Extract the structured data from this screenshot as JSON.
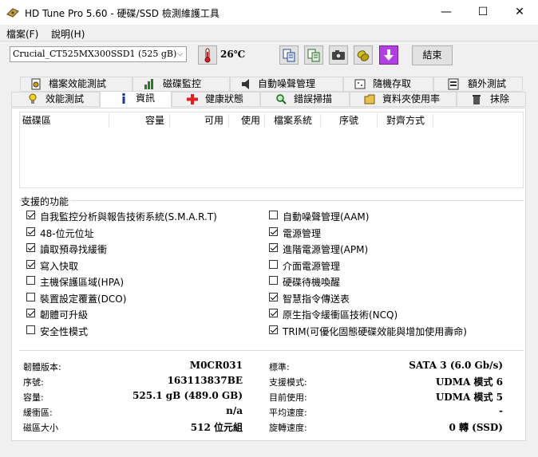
{
  "window": {
    "title": "HD Tune Pro 5.60 - 硬碟/SSD 檢測維護工具",
    "minimize": "—",
    "maximize": "☐",
    "close": "✕"
  },
  "menu": [
    "檔案(F)",
    "說明(H)"
  ],
  "toolbar": {
    "drive": "Crucial_CT525MX300SSD1 (525 gB)",
    "temperature": "26℃",
    "exit_label": "結束",
    "icons": [
      "thermometer-icon",
      "copy-text-icon",
      "copy-info-icon",
      "screenshot-icon",
      "options-icon",
      "save-icon"
    ],
    "colors": {
      "save_button": "#b040e0",
      "thermometer": "#d02020"
    }
  },
  "tabs_row1": [
    "檔案效能測試",
    "磁碟監控",
    "自動噪聲管理",
    "隨機存取",
    "額外測試"
  ],
  "tabs_row2": [
    "效能測試",
    "資訊",
    "健康狀態",
    "錯誤掃描",
    "資料夾使用率",
    "抹除"
  ],
  "active_tab": "資訊",
  "volume_table": {
    "headers": [
      "磁碟區",
      "容量",
      "可用",
      "使用",
      "檔案系統",
      "序號",
      "對齊方式"
    ]
  },
  "features": {
    "title": "支援的功能",
    "left": [
      {
        "label": "自我監控分析與報告技術系統(S.M.A.R.T)",
        "checked": true
      },
      {
        "label": "48-位元位址",
        "checked": true
      },
      {
        "label": "讀取預尋找緩衝",
        "checked": true
      },
      {
        "label": "寫入快取",
        "checked": true
      },
      {
        "label": "主機保護區域(HPA)",
        "checked": false
      },
      {
        "label": "裝置設定覆蓋(DCO)",
        "checked": false
      },
      {
        "label": "韌體可升級",
        "checked": true
      },
      {
        "label": "安全性模式",
        "checked": false
      }
    ],
    "right": [
      {
        "label": "自動噪聲管理(AAM)",
        "checked": false
      },
      {
        "label": "電源管理",
        "checked": true
      },
      {
        "label": "進階電源管理(APM)",
        "checked": true
      },
      {
        "label": "介面電源管理",
        "checked": false
      },
      {
        "label": "硬碟待機喚醒",
        "checked": false
      },
      {
        "label": "智慧指令傳送表",
        "checked": true
      },
      {
        "label": "原生指令緩衝區技術(NCQ)",
        "checked": true
      },
      {
        "label": "TRIM(可優化固態硬碟效能與增加使用壽命)",
        "checked": true
      }
    ]
  },
  "info_left": [
    {
      "label": "韌體版本:",
      "value": "M0CR031"
    },
    {
      "label": "序號:",
      "value": "163113837BE"
    },
    {
      "label": "容量:",
      "value": "525.1 gB (489.0 GB)"
    },
    {
      "label": "緩衝區:",
      "value": "n/a"
    },
    {
      "label": "磁區大小",
      "value": "512 位元組"
    }
  ],
  "info_right": [
    {
      "label": "標準:",
      "value": "SATA 3 (6.0 Gb/s)"
    },
    {
      "label": "支援模式:",
      "value": "UDMA 模式 6"
    },
    {
      "label": "目前使用:",
      "value": "UDMA 模式 5"
    },
    {
      "label": "平均速度:",
      "value": "-"
    },
    {
      "label": "旋轉速度:",
      "value": "0 轉 (SSD)"
    }
  ]
}
